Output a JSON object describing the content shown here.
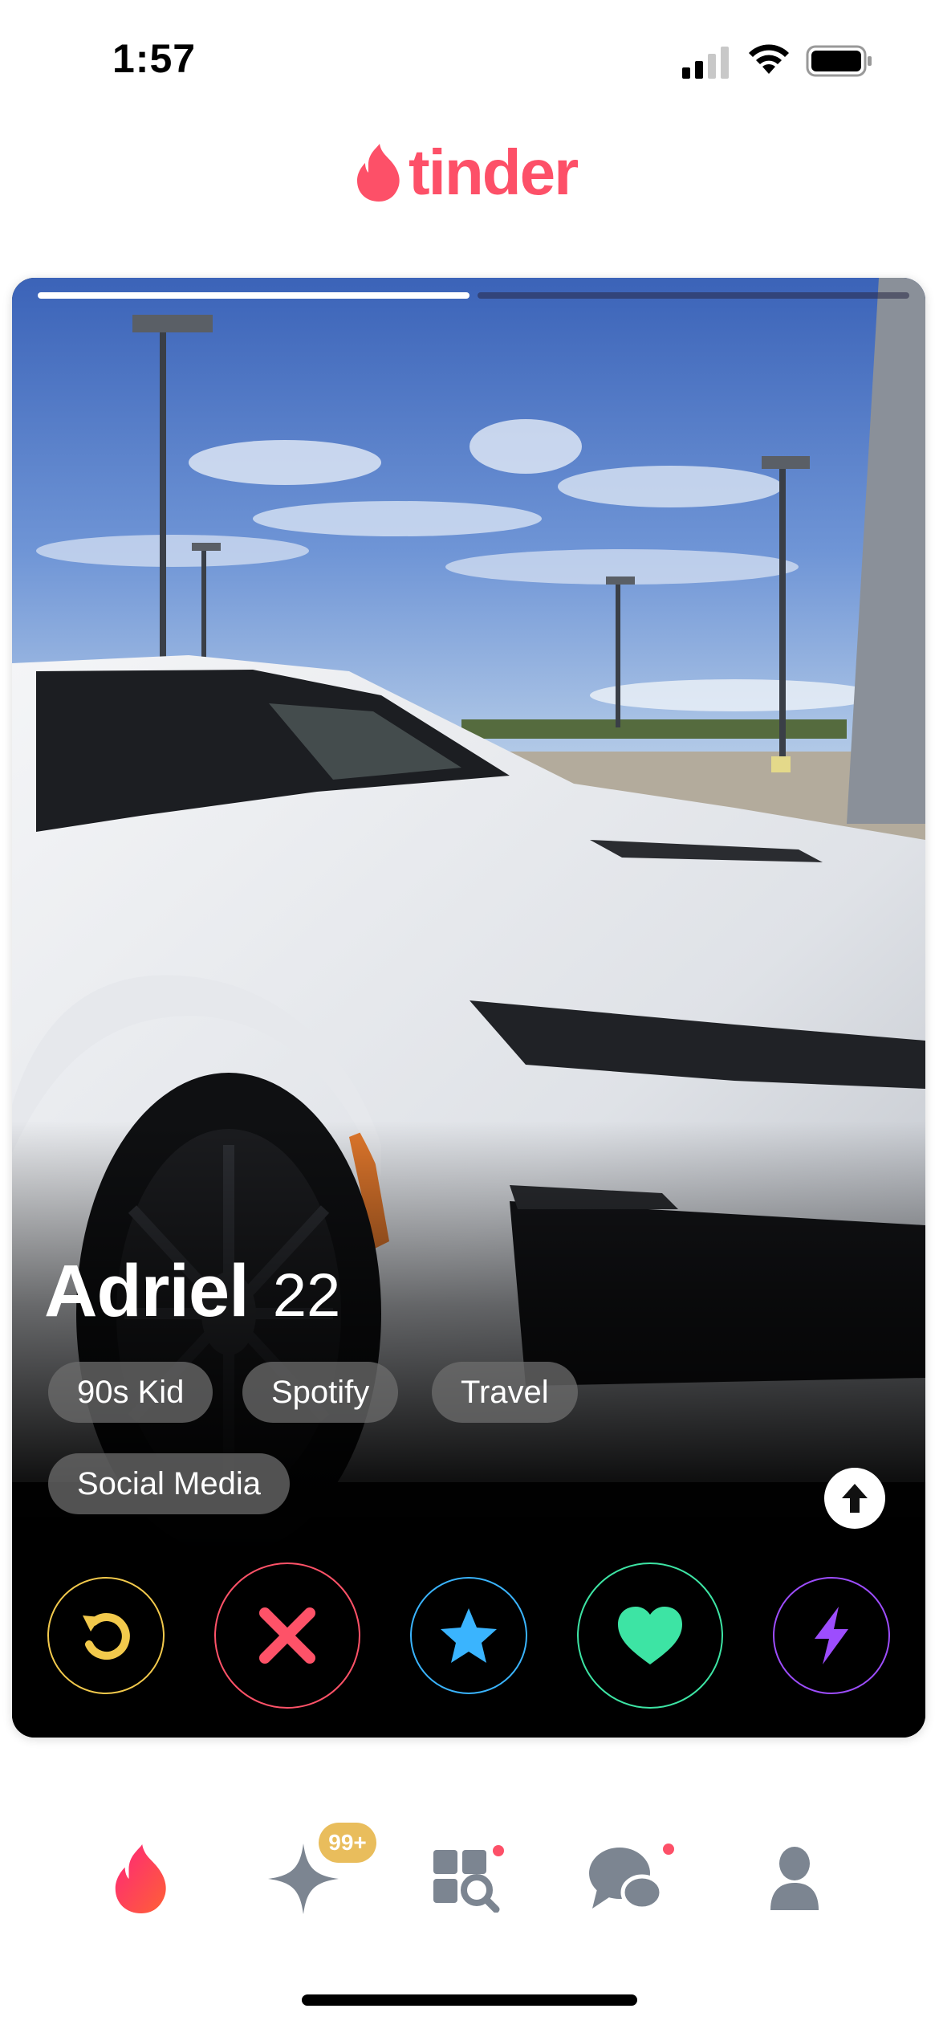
{
  "status_bar": {
    "time": "1:57"
  },
  "header": {
    "logo_text": "tinder"
  },
  "card": {
    "photo_count": 2,
    "current_photo": 1,
    "name": "Adriel",
    "age": "22",
    "tags": [
      "90s Kid",
      "Spotify",
      "Travel",
      "Social Media"
    ]
  },
  "actions": [
    {
      "name": "rewind",
      "icon": "rewind-icon",
      "color": "#f2c94c"
    },
    {
      "name": "nope",
      "icon": "close-icon",
      "color": "#fe5268"
    },
    {
      "name": "super-like",
      "icon": "star-icon",
      "color": "#3ab4fe"
    },
    {
      "name": "like",
      "icon": "heart-icon",
      "color": "#3de4a4"
    },
    {
      "name": "boost",
      "icon": "lightning-icon",
      "color": "#9d4dfd"
    }
  ],
  "bottom_nav": {
    "badge": "99+",
    "items": [
      "home",
      "gold-home",
      "explore",
      "chat",
      "profile"
    ]
  },
  "colors": {
    "brand": "#fd5068",
    "nav_inactive": "#7c8591"
  }
}
